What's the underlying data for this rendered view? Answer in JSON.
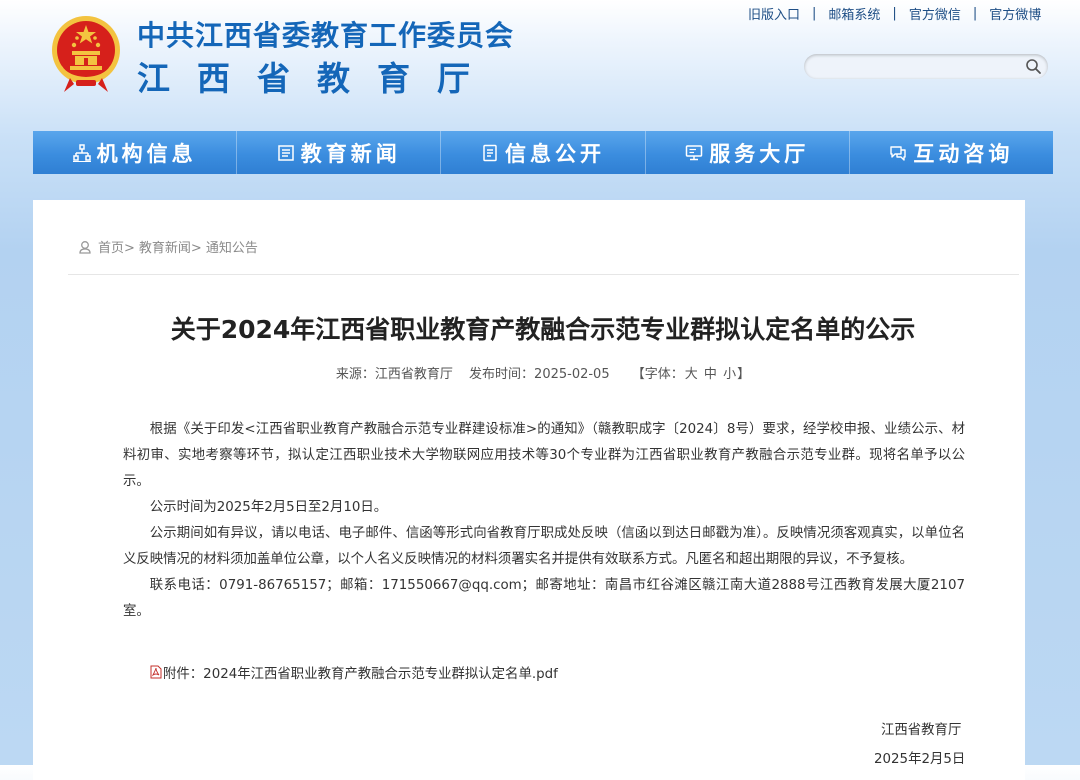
{
  "header": {
    "title_line1": "中共江西省委教育工作委员会",
    "title_line2": "江西省教育厅",
    "top_links": [
      "旧版入口",
      "邮箱系统",
      "官方微信",
      "官方微博"
    ],
    "search": {
      "placeholder": ""
    }
  },
  "nav": {
    "items": [
      {
        "label": "机构信息",
        "icon": "org-chart-icon"
      },
      {
        "label": "教育新闻",
        "icon": "news-icon"
      },
      {
        "label": "信息公开",
        "icon": "document-icon"
      },
      {
        "label": "服务大厅",
        "icon": "monitor-icon"
      },
      {
        "label": "互动咨询",
        "icon": "chat-icon"
      }
    ]
  },
  "breadcrumb": {
    "items": [
      "首页>",
      "教育新闻>",
      "通知公告"
    ]
  },
  "article": {
    "title": "关于2024年江西省职业教育产教融合示范专业群拟认定名单的公示",
    "meta": {
      "source": "来源：江西省教育厅",
      "date": "发布时间：2025-02-05",
      "font_label": "【字体：",
      "font_large": "大",
      "font_medium": "中",
      "font_small": "小",
      "font_end": "】"
    },
    "paragraphs": [
      "根据《关于印发<江西省职业教育产教融合示范专业群建设标准>的通知》（赣教职成字〔2024〕8号）要求，经学校申报、业绩公示、材料初审、实地考察等环节，拟认定江西职业技术大学物联网应用技术等30个专业群为江西省职业教育产教融合示范专业群。现将名单予以公示。",
      "公示时间为2025年2月5日至2月10日。",
      "公示期间如有异议，请以电话、电子邮件、信函等形式向省教育厅职成处反映（信函以到达日邮戳为准）。反映情况须客观真实，以单位名义反映情况的材料须加盖单位公章，以个人名义反映情况的材料须署实名并提供有效联系方式。凡匿名和超出期限的异议，不予复核。",
      "联系电话：0791-86765157；邮箱：171550667@qq.com；邮寄地址：南昌市红谷滩区赣江南大道2888号江西教育发展大厦2107室。"
    ],
    "attachment": "附件：2024年江西省职业教育产教融合示范专业群拟认定名单.pdf",
    "signature_org": "江西省教育厅",
    "signature_date": "2025年2月5日"
  },
  "colors": {
    "brand_blue": "#1466b8",
    "nav_blue": "#3b8ddf",
    "emblem_red": "#d6201b",
    "emblem_gold": "#f3c340"
  }
}
